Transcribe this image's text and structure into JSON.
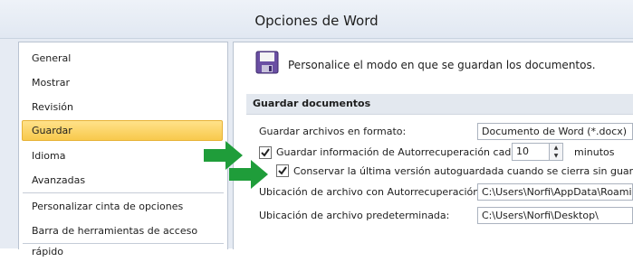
{
  "window": {
    "title": "Opciones de Word"
  },
  "sidebar": {
    "items": [
      {
        "label": "General"
      },
      {
        "label": "Mostrar"
      },
      {
        "label": "Revisión"
      },
      {
        "label": "Guardar"
      },
      {
        "label": "Idioma"
      },
      {
        "label": "Avanzadas"
      },
      {
        "label": "Personalizar cinta de opciones"
      },
      {
        "label": "Barra de herramientas de acceso rápido"
      }
    ],
    "selected": "Guardar"
  },
  "main": {
    "intro": "Personalice el modo en que se guardan los documentos.",
    "section_title": "Guardar documentos",
    "format_label": "Guardar archivos en formato:",
    "format_value": "Documento de Word (*.docx)",
    "autorecover_label": "Guardar información de Autorrecuperación cada",
    "autorecover_checked": true,
    "autorecover_minutes": "10",
    "minutes_label": "minutos",
    "keep_last_label": "Conservar la última versión autoguardada cuando se cierra sin guardar",
    "keep_last_checked": true,
    "autorecover_location_label": "Ubicación de archivo con Autorrecuperación:",
    "autorecover_location_value": "C:\\Users\\Norfi\\AppData\\Roaming",
    "default_location_label": "Ubicación de archivo predeterminada:",
    "default_location_value": "C:\\Users\\Norfi\\Desktop\\"
  },
  "colors": {
    "selection": "#f8c94c",
    "arrow": "#1f9d3a",
    "accent_icon": "#6a4fa3"
  }
}
